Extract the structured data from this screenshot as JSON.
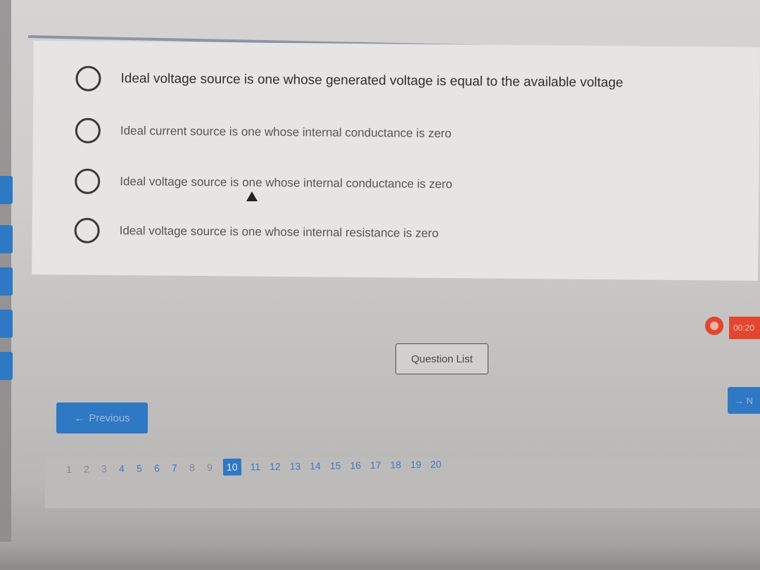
{
  "question": {
    "options": [
      {
        "label": "Ideal voltage source is one whose generated voltage is equal to the available voltage"
      },
      {
        "label": "Ideal current source is one whose internal conductance is zero"
      },
      {
        "label": "Ideal voltage source is one whose internal conductance is zero"
      },
      {
        "label": "Ideal voltage source is one whose internal resistance is zero"
      }
    ]
  },
  "controls": {
    "question_list_label": "Question List",
    "previous_label": "Previous",
    "previous_arrow": "←",
    "next_label": "→ N",
    "timer_text": "00:20",
    "alarm_icon": "alarm-clock-icon",
    "accent_color": "#2f78c4",
    "timer_color": "#e3462e"
  },
  "pagination": {
    "pages": [
      "1",
      "2",
      "3",
      "4",
      "5",
      "6",
      "7",
      "8",
      "9",
      "10",
      "11",
      "12",
      "13",
      "14",
      "15",
      "16",
      "17",
      "18",
      "19",
      "20"
    ],
    "current": "10"
  }
}
